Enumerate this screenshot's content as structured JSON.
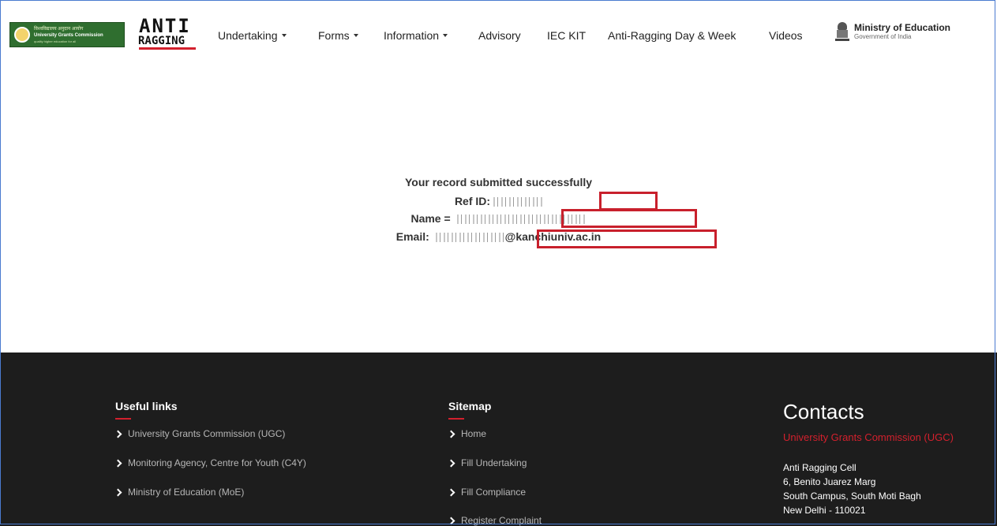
{
  "header": {
    "ugc_logo": {
      "line1": "विश्वविद्यालय अनुदान आयोग",
      "line2": "University Grants Commission",
      "line3": "quality higher education for all"
    },
    "anti_ragging_logo": {
      "top": "ANTI",
      "bottom": "RAGGING"
    },
    "nav": [
      {
        "label": "Undertaking",
        "dropdown": true
      },
      {
        "label": "Forms",
        "dropdown": true
      },
      {
        "label": "Information",
        "dropdown": true
      },
      {
        "label": "Advisory",
        "dropdown": false
      },
      {
        "label": "IEC KIT",
        "dropdown": false
      },
      {
        "label": "Anti-Ragging Day & Week",
        "dropdown": false
      },
      {
        "label": "Videos",
        "dropdown": false
      }
    ],
    "moe": {
      "title": "Ministry of Education",
      "subtitle": "Government of India"
    }
  },
  "result": {
    "success_message": "Your record submitted successfully",
    "ref_label": "Ref ID:",
    "name_label": "Name =",
    "email_label": "Email:",
    "email_domain": "@kanchiuniv.ac.in"
  },
  "footer": {
    "useful_links": {
      "title": "Useful links",
      "items": [
        "University Grants Commission (UGC)",
        "Monitoring Agency, Centre for Youth (C4Y)",
        "Ministry of Education (MoE)"
      ]
    },
    "sitemap": {
      "title": "Sitemap",
      "items": [
        "Home",
        "Fill Undertaking",
        "Fill Compliance",
        "Register Complaint"
      ]
    },
    "contacts": {
      "title": "Contacts",
      "org": "University Grants Commission (UGC)",
      "address": [
        "Anti Ragging Cell",
        "6, Benito Juarez Marg",
        "South Campus, South Moti Bagh",
        "New Delhi - 110021"
      ]
    }
  },
  "colors": {
    "accent_red": "#d3202d",
    "footer_bg": "#1d1d1d",
    "ugc_green": "#2f6e2f"
  }
}
